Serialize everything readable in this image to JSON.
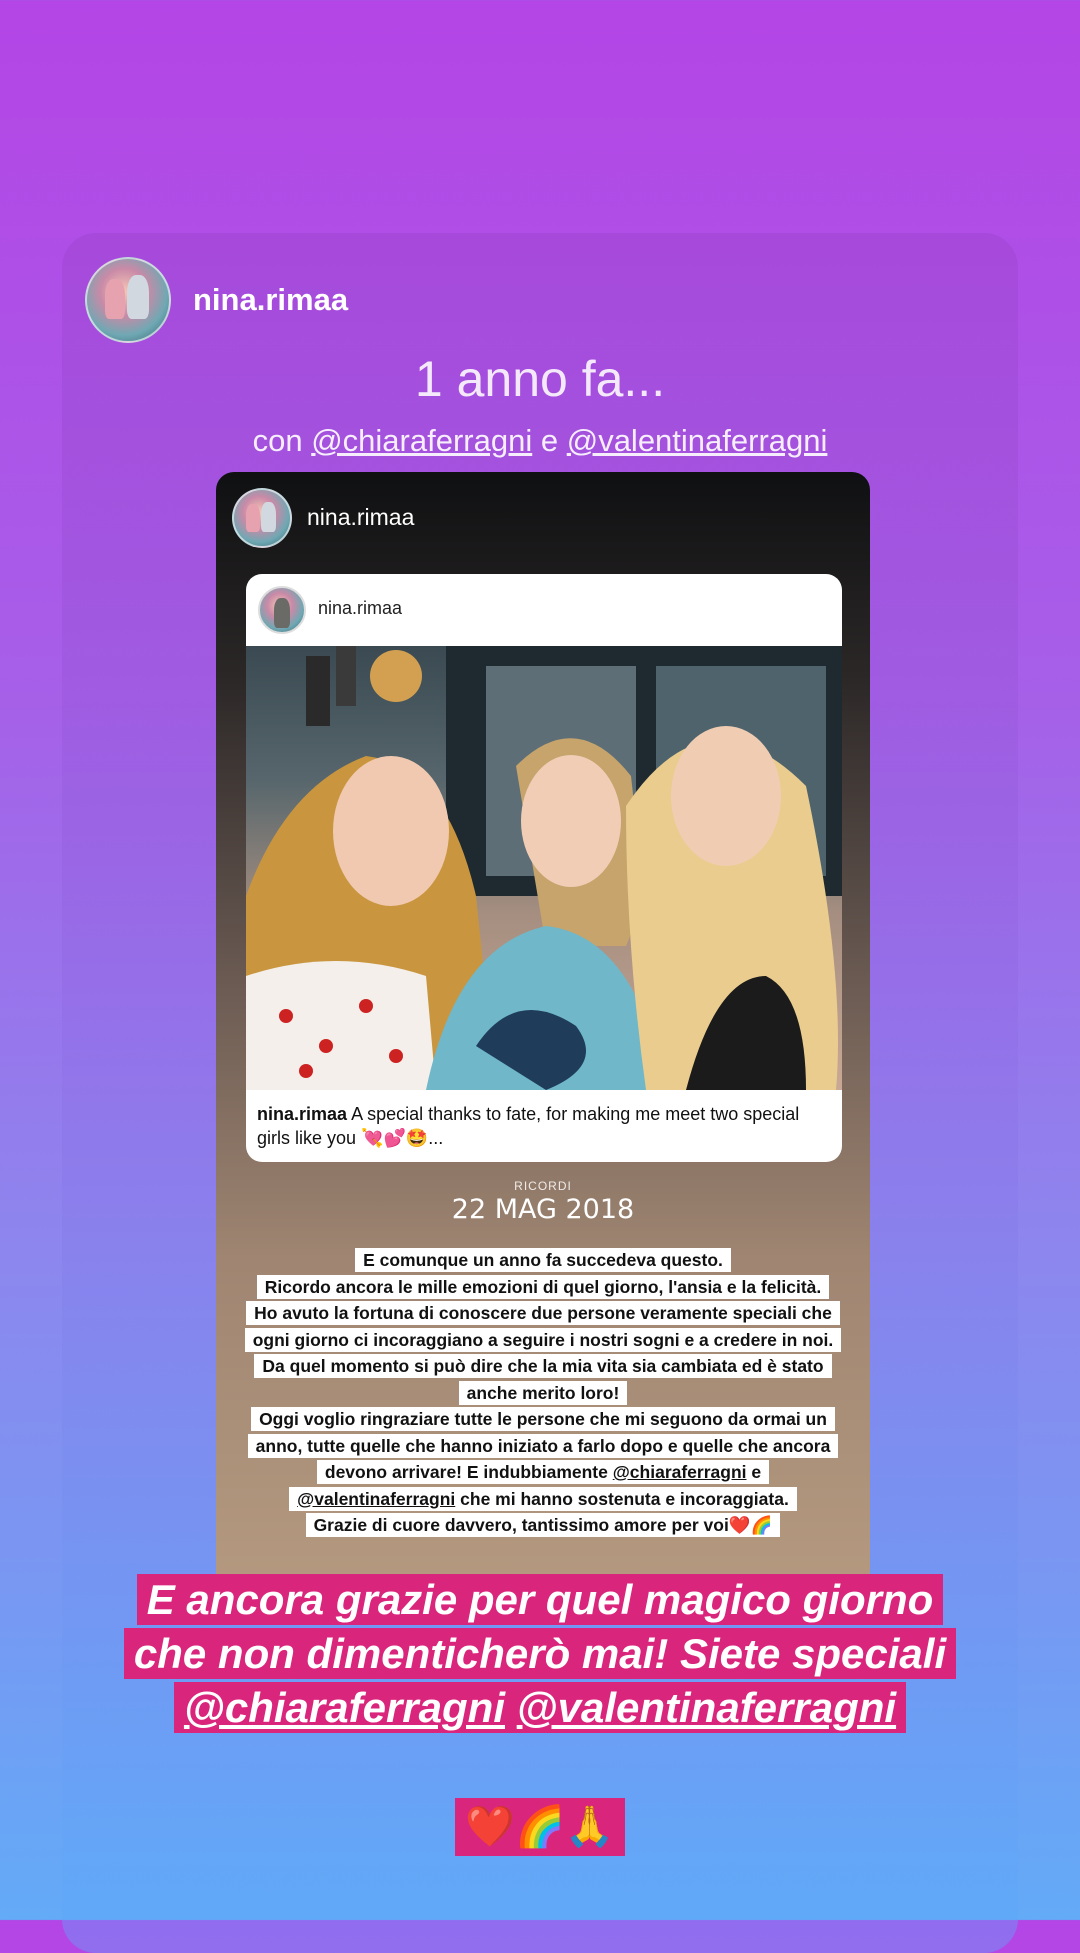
{
  "story": {
    "username": "nina.rimaa",
    "headline": "1 anno fa...",
    "with_prefix": "con",
    "with_mention_1": "@chiaraferragni",
    "with_conj": "e",
    "with_mention_2": "@valentinaferragni"
  },
  "inner_story": {
    "username": "nina.rimaa",
    "post": {
      "username": "nina.rimaa",
      "caption_user": "nina.rimaa",
      "caption_text": "A special thanks to fate, for making me meet two special girls like you 💘💕🤩..."
    },
    "memories_label": "RICORDI",
    "memories_date": "22 MAG 2018",
    "text_lines": [
      "E comunque un anno fa succedeva questo.",
      "Ricordo ancora le mille emozioni di quel giorno, l'ansia e la felicità.",
      "Ho avuto la fortuna di conoscere due persone veramente speciali che ogni giorno ci incoraggiano a seguire i nostri sogni e a credere in noi.",
      "Da quel momento si può dire che la mia vita sia cambiata ed è stato anche merito loro!",
      "Oggi voglio ringraziare tutte le persone che mi seguono da ormai un anno, tutte quelle che hanno iniziato a farlo dopo e quelle che ancora devono arrivare! E indubbiamente",
      "@chiaraferragni",
      "e",
      "@valentinaferragni",
      "che mi hanno sostenuta e incoraggiata.",
      "Grazie di cuore davvero, tantissimo amore per voi❤️🌈"
    ]
  },
  "big_caption": {
    "line_1": "E ancora grazie per quel magico giorno che non dimenticherò mai! Siete speciali",
    "mention_1": "@chiaraferragni",
    "mention_2": "@valentinaferragni",
    "emojis": "❤️🌈🙏"
  },
  "colors": {
    "highlight": "#d9267c",
    "background_top": "#b445e6",
    "background_bottom": "#63aaf7"
  }
}
